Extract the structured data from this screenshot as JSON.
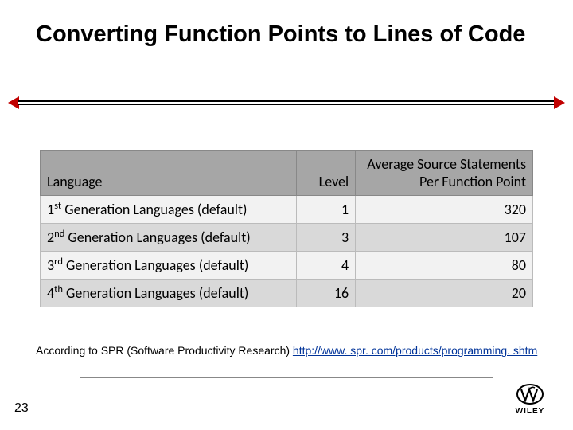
{
  "title": "Converting Function Points to Lines of Code",
  "table": {
    "headers": {
      "language": "Language",
      "level": "Level",
      "avg": "Average Source Statements Per Function Point"
    },
    "rows": [
      {
        "lang_pre": "1",
        "lang_sup": "st",
        "lang_post": " Generation Languages (default)",
        "level": "1",
        "avg": "320"
      },
      {
        "lang_pre": "2",
        "lang_sup": "nd",
        "lang_post": " Generation Languages (default)",
        "level": "3",
        "avg": "107"
      },
      {
        "lang_pre": "3",
        "lang_sup": "rd",
        "lang_post": " Generation Languages (default)",
        "level": "4",
        "avg": "80"
      },
      {
        "lang_pre": "4",
        "lang_sup": "th",
        "lang_post": " Generation Languages (default)",
        "level": "16",
        "avg": "20"
      }
    ]
  },
  "source": {
    "prefix": "According to SPR (Software Productivity Research) ",
    "link_text": "http://www. spr. com/products/programming. shtm",
    "link_href": "http://www.spr.com/products/programming.shtm"
  },
  "page_number": "23",
  "logo": {
    "word": "WILEY"
  }
}
